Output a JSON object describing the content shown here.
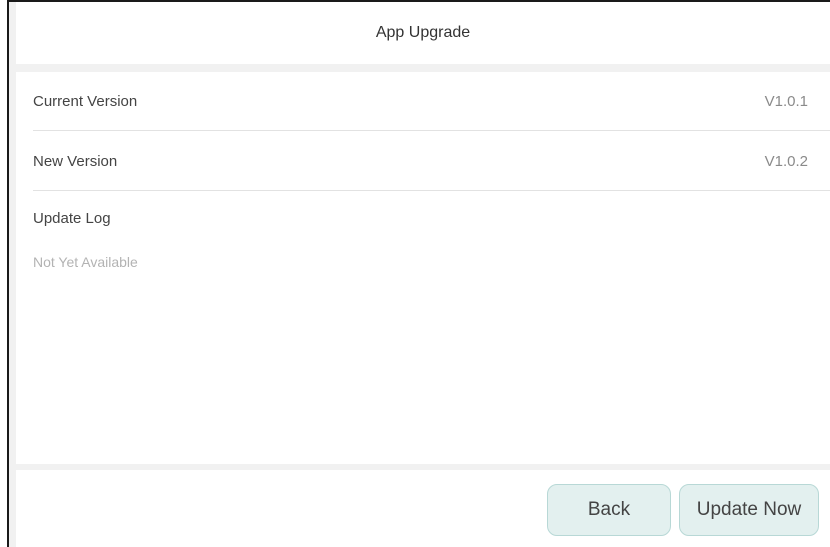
{
  "header": {
    "title": "App Upgrade"
  },
  "info": {
    "current_version_label": "Current Version",
    "current_version_value": "V1.0.1",
    "new_version_label": "New Version",
    "new_version_value": "V1.0.2"
  },
  "update_log": {
    "title": "Update Log",
    "body": "Not Yet Available"
  },
  "footer": {
    "back_label": "Back",
    "update_label": "Update Now"
  },
  "colors": {
    "background": "#f1f1f1",
    "panel": "#ffffff",
    "button_fill": "#e3f0ef",
    "button_border": "#b8d8d6",
    "muted_text": "#8a8a8a",
    "placeholder_text": "#b3b3b3"
  }
}
